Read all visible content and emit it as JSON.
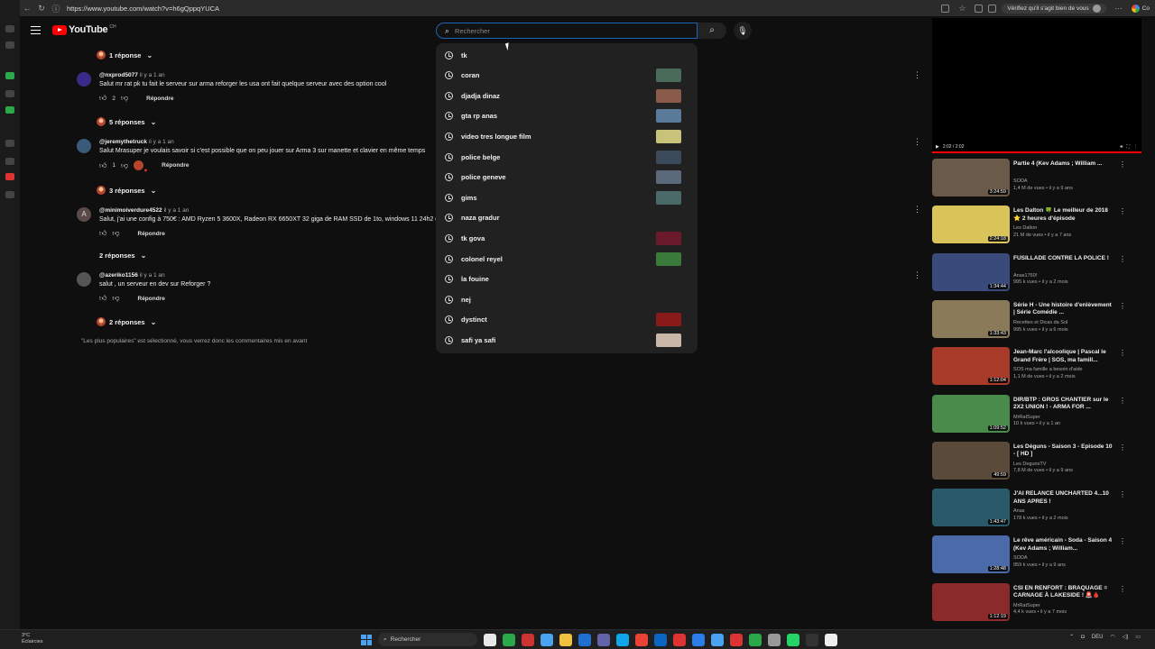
{
  "browser": {
    "url": "https://www.youtube.com/watch?v=h6gQppqYUCA",
    "verify_label": "Vérifiez qu'il s'agit bien de vous",
    "connection_label": "Co"
  },
  "header": {
    "logo_text": "YouTube",
    "country_code": "CH",
    "search_placeholder": "Rechercher"
  },
  "comments": {
    "reply_toggles": [
      "1 réponse",
      "5 réponses",
      "3 réponses",
      "2 réponses",
      "2 réponses"
    ],
    "items": [
      {
        "author": "@nxprod5077",
        "time": "il y a 1 an",
        "text": "Salut mr rat pk tu fait le serveur sur arma reforger les usa ont fait quelque serveur avec des option cool",
        "likes": "2",
        "reply_label": "Répondre"
      },
      {
        "author": "@jeremythetruck",
        "time": "il y a 1 an",
        "text": "Salut Mrasuper je voulais savoir si c'est possible que on peu jouer sur Arma 3 sur manette et clavier en même temps",
        "likes": "1",
        "reply_label": "Répondre"
      },
      {
        "author": "@minimoiverdure4522",
        "time": "il y a 1 an",
        "text": "Salut, j'ai une config à 750€ : AMD Ryzen 5 3600X, Radeon RX 6650XT 32 giga de RAM SSD de 1to, windows 11 24h2 c",
        "likes": "",
        "reply_label": "Répondre",
        "avatar_letter": "A"
      },
      {
        "author": "@azeriko1156",
        "time": "il y a 1 an",
        "text": "salut , un serveur en dev sur Reforger ?",
        "likes": "",
        "reply_label": "Répondre"
      }
    ],
    "footer_note": "\"Les plus populaires\" est sélectionné, vous verrez donc les commentaires mis en avant"
  },
  "suggestions": [
    {
      "label": "tk",
      "thumb": ""
    },
    {
      "label": "coran",
      "thumb": "#4a6a5a"
    },
    {
      "label": "djadja dinaz",
      "thumb": "#8a5a4a"
    },
    {
      "label": "gta rp anas",
      "thumb": "#5a7a9a"
    },
    {
      "label": "video tres longue film",
      "thumb": "#c9c27a"
    },
    {
      "label": "police belge",
      "thumb": "#3a4a5a"
    },
    {
      "label": "police geneve",
      "thumb": "#5a6a7a"
    },
    {
      "label": "gims",
      "thumb": "#4a6a6a"
    },
    {
      "label": "naza gradur",
      "thumb": ""
    },
    {
      "label": "tk gova",
      "thumb": "#6a1a2a"
    },
    {
      "label": "colonel reyel",
      "thumb": "#3a7a3a"
    },
    {
      "label": "la fouine",
      "thumb": ""
    },
    {
      "label": "nej",
      "thumb": ""
    },
    {
      "label": "dystinct",
      "thumb": "#8a1a1a"
    },
    {
      "label": "safi ya safi",
      "thumb": "#c9b8a8"
    }
  ],
  "player": {
    "time": "2:02 / 2:02"
  },
  "recommendations": [
    {
      "title": "Partie 4 (Kev Adams ; William ...",
      "channel": "SODA",
      "meta": "1,4 M de vues • il y a 9 ans",
      "duration": "3:24:59",
      "color": "#6a5a4a"
    },
    {
      "title": "Les Dalton 🍀 Le meilleur de 2018 ⭐ 2 heures d'épisode",
      "channel": "Les Dalton",
      "meta": "21 M de vues • il y a 7 ans",
      "duration": "2:24:18",
      "color": "#d9c45a"
    },
    {
      "title": "FUSILLADE CONTRE LA POLICE !",
      "channel": "Anas1760!",
      "meta": "995 k vues • il y a 2 mois",
      "duration": "1:34:44",
      "color": "#3a4a7a"
    },
    {
      "title": "Série H - Une histoire d'enlèvement | Série Comédie ...",
      "channel": "Recettes et Dicas da Sol",
      "meta": "995 k vues • il y a 6 mois",
      "duration": "1:33:43",
      "color": "#8a7a5a"
    },
    {
      "title": "Jean-Marc l'alcoolique | Pascal le Grand Frère | SOS, ma famill...",
      "channel": "SOS ma famille a besoin d'aide",
      "meta": "1,1 M de vues • il y a 2 mois",
      "duration": "1:12:04",
      "color": "#a83a2a"
    },
    {
      "title": "DIR/BTP : GROS CHANTIER sur le 2X2 UNION ! - ARMA FOR ...",
      "channel": "MrRatSuper",
      "meta": "10 k vues • il y a 1 an",
      "duration": "1:09:52",
      "color": "#4a8a4a"
    },
    {
      "title": "Les Déguns - Saison 3 - Episode 10 - [ HD ]",
      "channel": "Les DegunsTV",
      "meta": "7,8 M de vues • il y a 9 ans",
      "duration": "49:59",
      "color": "#5a4a3a"
    },
    {
      "title": "J'AI RELANCÉ UNCHARTED 4...10 ANS APRES !",
      "channel": "Anas",
      "meta": "178 k vues • il y a 2 mois",
      "duration": "1:43:47",
      "color": "#2a5a6a"
    },
    {
      "title": "Le rêve américain - Soda - Saison 4 (Kev Adams ; William...",
      "channel": "SODA",
      "meta": "959 k vues • il y a 9 ans",
      "duration": "1:28:48",
      "color": "#4a6aaa"
    },
    {
      "title": "CSI EN RENFORT : BRAQUAGE = CARNAGE À LAKESIDE ! 🚨🩸",
      "channel": "MrRatSuper",
      "meta": "4,4 k vues • il y a 7 mois",
      "duration": "1:12:19",
      "color": "#8a2a2a"
    }
  ],
  "taskbar": {
    "weather_temp": "3°C",
    "weather_desc": "Éclaircies",
    "search_label": "Rechercher",
    "lang": "DEU",
    "app_colors": [
      "#e8e8e8",
      "#2aa84a",
      "#c33",
      "#4aa3f0",
      "#f0c040",
      "#1e6fd0",
      "#6264a7",
      "#0ea5e9",
      "#ea4335",
      "#0a66c2",
      "#d33",
      "#2b7de9",
      "#4aa3f0",
      "#d33",
      "#2aa84a",
      "#999",
      "#25d366",
      "#333",
      "#eee"
    ]
  }
}
